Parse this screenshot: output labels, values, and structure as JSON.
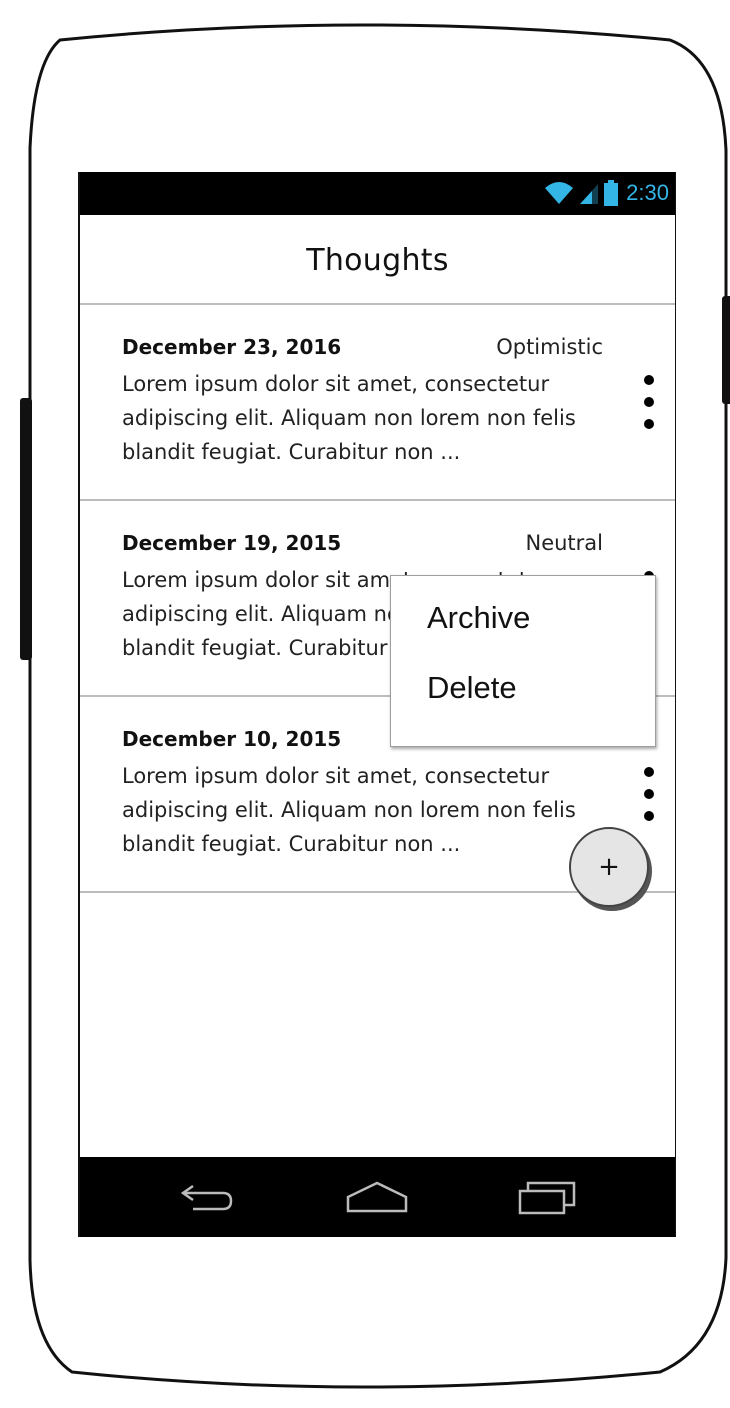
{
  "status_bar": {
    "time": "2:30"
  },
  "app_bar": {
    "title": "Thoughts"
  },
  "entries": [
    {
      "date": "December 23, 2016",
      "mood": "Optimistic",
      "text": "Lorem ipsum dolor sit amet, consectetur adipiscing elit. Aliquam non lorem non felis blandit feugiat. Curabitur non ..."
    },
    {
      "date": "December 19, 2015",
      "mood": "Neutral",
      "text": "Lorem ipsum dolor sit amet, consectetur adipiscing elit. Aliquam non lorem non felis blandit feugiat. Curabitur non ..."
    },
    {
      "date": "December 10, 2015",
      "mood": "",
      "text": "Lorem ipsum dolor sit amet, consectetur adipiscing elit. Aliquam non lorem non felis blandit feugiat. Curabitur non ..."
    }
  ],
  "popup_menu": {
    "items": [
      "Archive",
      "Delete"
    ]
  },
  "fab": {
    "label": "+"
  },
  "icons": {
    "status": [
      "wifi-icon",
      "signal-icon",
      "battery-icon"
    ],
    "nav": [
      "back-icon",
      "home-icon",
      "recents-icon"
    ],
    "entry_actions": "more-vertical-icon"
  },
  "colors": {
    "status_time": "#33b5e5",
    "divider": "#bdbdbd",
    "bars": "#000000"
  }
}
